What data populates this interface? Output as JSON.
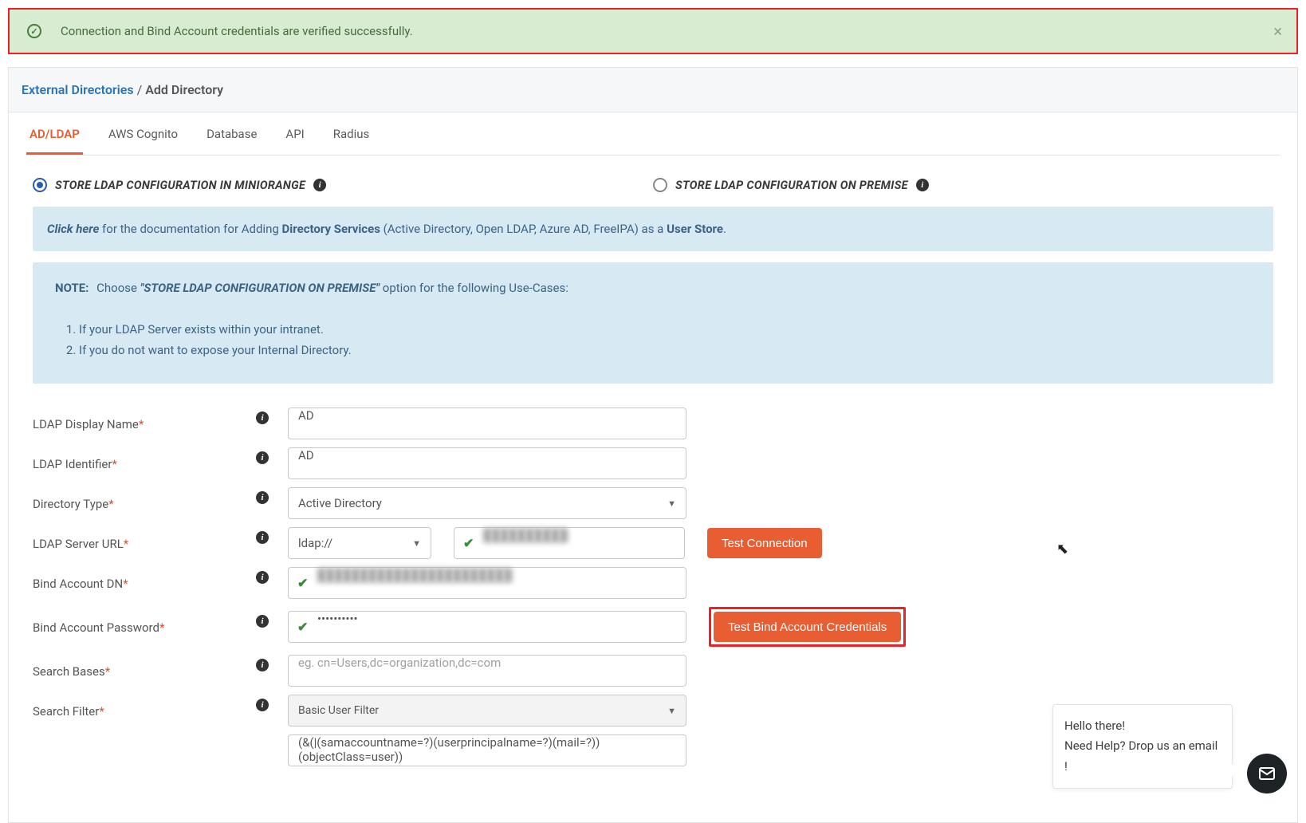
{
  "alert": {
    "message": "Connection and Bind Account credentials are verified successfully."
  },
  "breadcrumb": {
    "link": "External Directories",
    "sep": "/",
    "current": "Add Directory"
  },
  "tabs": [
    "AD/LDAP",
    "AWS Cognito",
    "Database",
    "API",
    "Radius"
  ],
  "radios": {
    "miniorange": "STORE LDAP CONFIGURATION IN MINIORANGE",
    "onpremise": "STORE LDAP CONFIGURATION ON PREMISE"
  },
  "docbox": {
    "click_here": "Click here",
    "pre": " for the documentation for Adding ",
    "ds": "Directory Services",
    "mid": " (Active Directory, Open LDAP, Azure AD, FreeIPA) as a ",
    "us": "User Store",
    "tail": "."
  },
  "notebox": {
    "note_label": "NOTE:",
    "choose": "Choose ",
    "quoted": "\"STORE LDAP CONFIGURATION ON PREMISE\"",
    "tail": " option for the following Use-Cases:",
    "items": [
      "If your LDAP Server exists within your intranet.",
      "If you do not want to expose your Internal Directory."
    ]
  },
  "form": {
    "ldap_display_name": {
      "label": "LDAP Display Name",
      "value": "AD"
    },
    "ldap_identifier": {
      "label": "LDAP Identifier",
      "value": "AD"
    },
    "directory_type": {
      "label": "Directory Type",
      "value": "Active Directory"
    },
    "ldap_server_url": {
      "label": "LDAP Server URL",
      "scheme": "ldap://",
      "host": "██████████",
      "test_btn": "Test Connection"
    },
    "bind_dn": {
      "label": "Bind Account DN",
      "value": "███████████████████████"
    },
    "bind_pw": {
      "label": "Bind Account Password",
      "value": "••••••••••",
      "test_btn": "Test Bind Account Credentials"
    },
    "search_bases": {
      "label": "Search Bases",
      "placeholder": "eg. cn=Users,dc=organization,dc=com"
    },
    "search_filter": {
      "label": "Search Filter",
      "value": "Basic User Filter",
      "expr": "(&(|(samaccountname=?)(userprincipalname=?)(mail=?))(objectClass=user))"
    }
  },
  "chat": {
    "line1": "Hello there!",
    "line2": "Need Help? Drop us an email !"
  }
}
